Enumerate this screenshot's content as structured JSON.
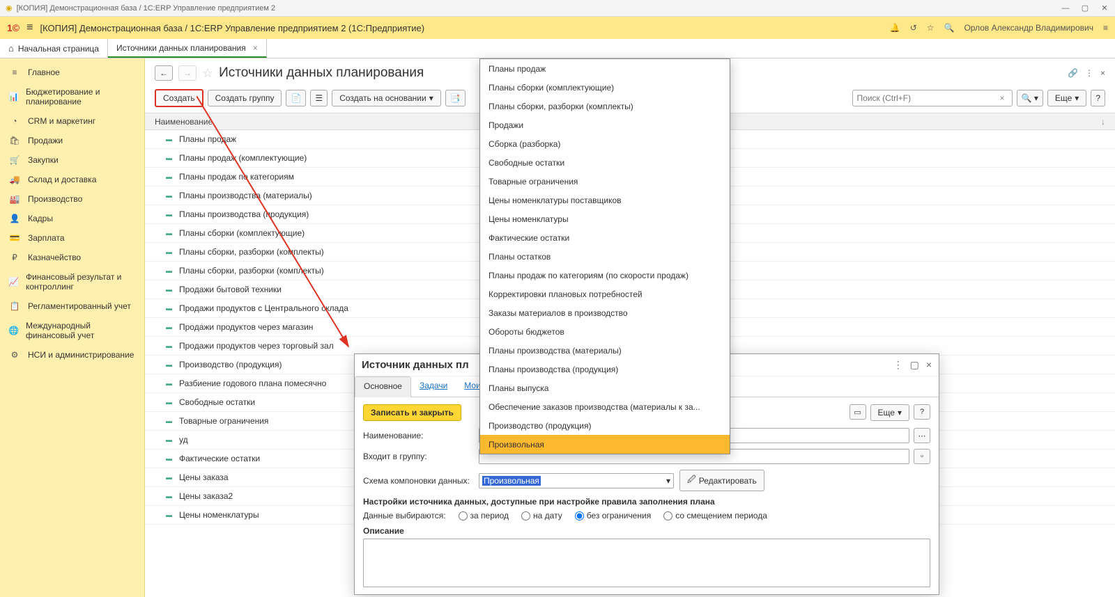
{
  "window_title": "[КОПИЯ] Демонстрационная база / 1С:ERP Управление предприятием 2",
  "header_title": "[КОПИЯ] Демонстрационная база / 1С:ERP Управление предприятием 2  (1С:Предприятие)",
  "user_name": "Орлов Александр Владимирович",
  "tabs": {
    "home": "Начальная страница",
    "current": "Источники данных планирования"
  },
  "sidebar": [
    {
      "icon": "≡",
      "label": "Главное"
    },
    {
      "icon": "📊",
      "label": "Бюджетирование и планирование"
    },
    {
      "icon": "◔",
      "label": "CRM и маркетинг"
    },
    {
      "icon": "🛍",
      "label": "Продажи"
    },
    {
      "icon": "🛒",
      "label": "Закупки"
    },
    {
      "icon": "🚚",
      "label": "Склад и доставка"
    },
    {
      "icon": "🏭",
      "label": "Производство"
    },
    {
      "icon": "👤",
      "label": "Кадры"
    },
    {
      "icon": "💳",
      "label": "Зарплата"
    },
    {
      "icon": "₽",
      "label": "Казначейство"
    },
    {
      "icon": "📈",
      "label": "Финансовый результат и контроллинг"
    },
    {
      "icon": "📋",
      "label": "Регламентированный учет"
    },
    {
      "icon": "🌐",
      "label": "Международный финансовый учет"
    },
    {
      "icon": "⚙",
      "label": "НСИ и администрирование"
    }
  ],
  "page_title": "Источники данных планирования",
  "toolbar": {
    "create": "Создать",
    "create_group": "Создать группу",
    "create_based": "Создать на основании",
    "search_placeholder": "Поиск (Ctrl+F)",
    "more": "Еще"
  },
  "table_header": "Наименование",
  "rows": [
    "Планы продаж",
    "Планы продаж (комплектующие)",
    "Планы продаж по категориям",
    "Планы производства (материалы)",
    "Планы производства (продукция)",
    "Планы сборки (комплектующие)",
    "Планы сборки, разборки (комплекты)",
    "Планы сборки, разборки (комплекты)",
    "Продажи бытовой техники",
    "Продажи продуктов с Центрального склада",
    "Продажи продуктов через магазин",
    "Продажи продуктов через торговый зал",
    "Производство (продукция)",
    "Разбиение годового плана помесячно",
    "Свободные остатки",
    "Товарные ограничения",
    "уд",
    "Фактические остатки",
    "Цены заказа",
    "Цены заказа2",
    "Цены номенклатуры"
  ],
  "modal": {
    "title": "Источник данных пл",
    "tabs": {
      "main": "Основное",
      "tasks": "Задачи",
      "my": "Мои"
    },
    "save_close": "Записать и закрыть",
    "more": "Еще",
    "name_label": "Наименование:",
    "group_label": "Входит в группу:",
    "scheme_label": "Схема компоновки данных:",
    "scheme_value": "Произвольная",
    "edit_btn": "Редактировать",
    "section": "Настройки источника данных, доступные при настройке правила заполнения плана",
    "radio_label": "Данные выбираются:",
    "radios": [
      "за период",
      "на дату",
      "без ограничения",
      "со смещением периода"
    ],
    "desc_label": "Описание"
  },
  "dropdown": [
    "Планы продаж",
    "Планы сборки (комплектующие)",
    "Планы сборки, разборки (комплекты)",
    "Продажи",
    "Сборка (разборка)",
    "Свободные остатки",
    "Товарные ограничения",
    "Цены номенклатуры поставщиков",
    "Цены номенклатуры",
    "Фактические остатки",
    "Планы остатков",
    "Планы продаж по категориям (по скорости продаж)",
    "Корректировки плановых потребностей",
    "Заказы материалов в производство",
    "Обороты бюджетов",
    "Планы производства (материалы)",
    "Планы производства (продукция)",
    "Планы выпуска",
    "Обеспечение заказов производства (материалы к за...",
    "Производство (продукция)",
    "Произвольная"
  ],
  "dropdown_selected_index": 20
}
